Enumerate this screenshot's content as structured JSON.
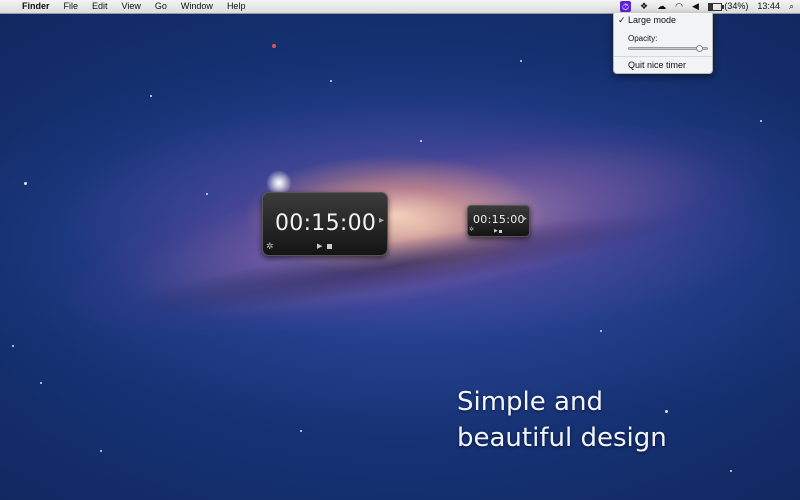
{
  "menubar": {
    "apple_icon": "apple-icon",
    "app_name": "Finder",
    "items": [
      "File",
      "Edit",
      "View",
      "Go",
      "Window",
      "Help"
    ],
    "status": {
      "timer_icon": "nice-timer-icon",
      "battery_text": "(34%)",
      "clock": "13:44"
    }
  },
  "dropdown": {
    "large_mode_check": "✓",
    "large_mode": "Large mode",
    "opacity_label": "Opacity:",
    "opacity_value": 0.95,
    "quit": "Quit nice timer"
  },
  "timers": {
    "large": {
      "time": "00:15:00"
    },
    "small": {
      "time": "00:15:00"
    }
  },
  "tagline": {
    "line1": "Simple and",
    "line2": "beautiful design"
  },
  "colors": {
    "timer_accent": "#5b22d8",
    "wallpaper_base": "#15306f"
  }
}
